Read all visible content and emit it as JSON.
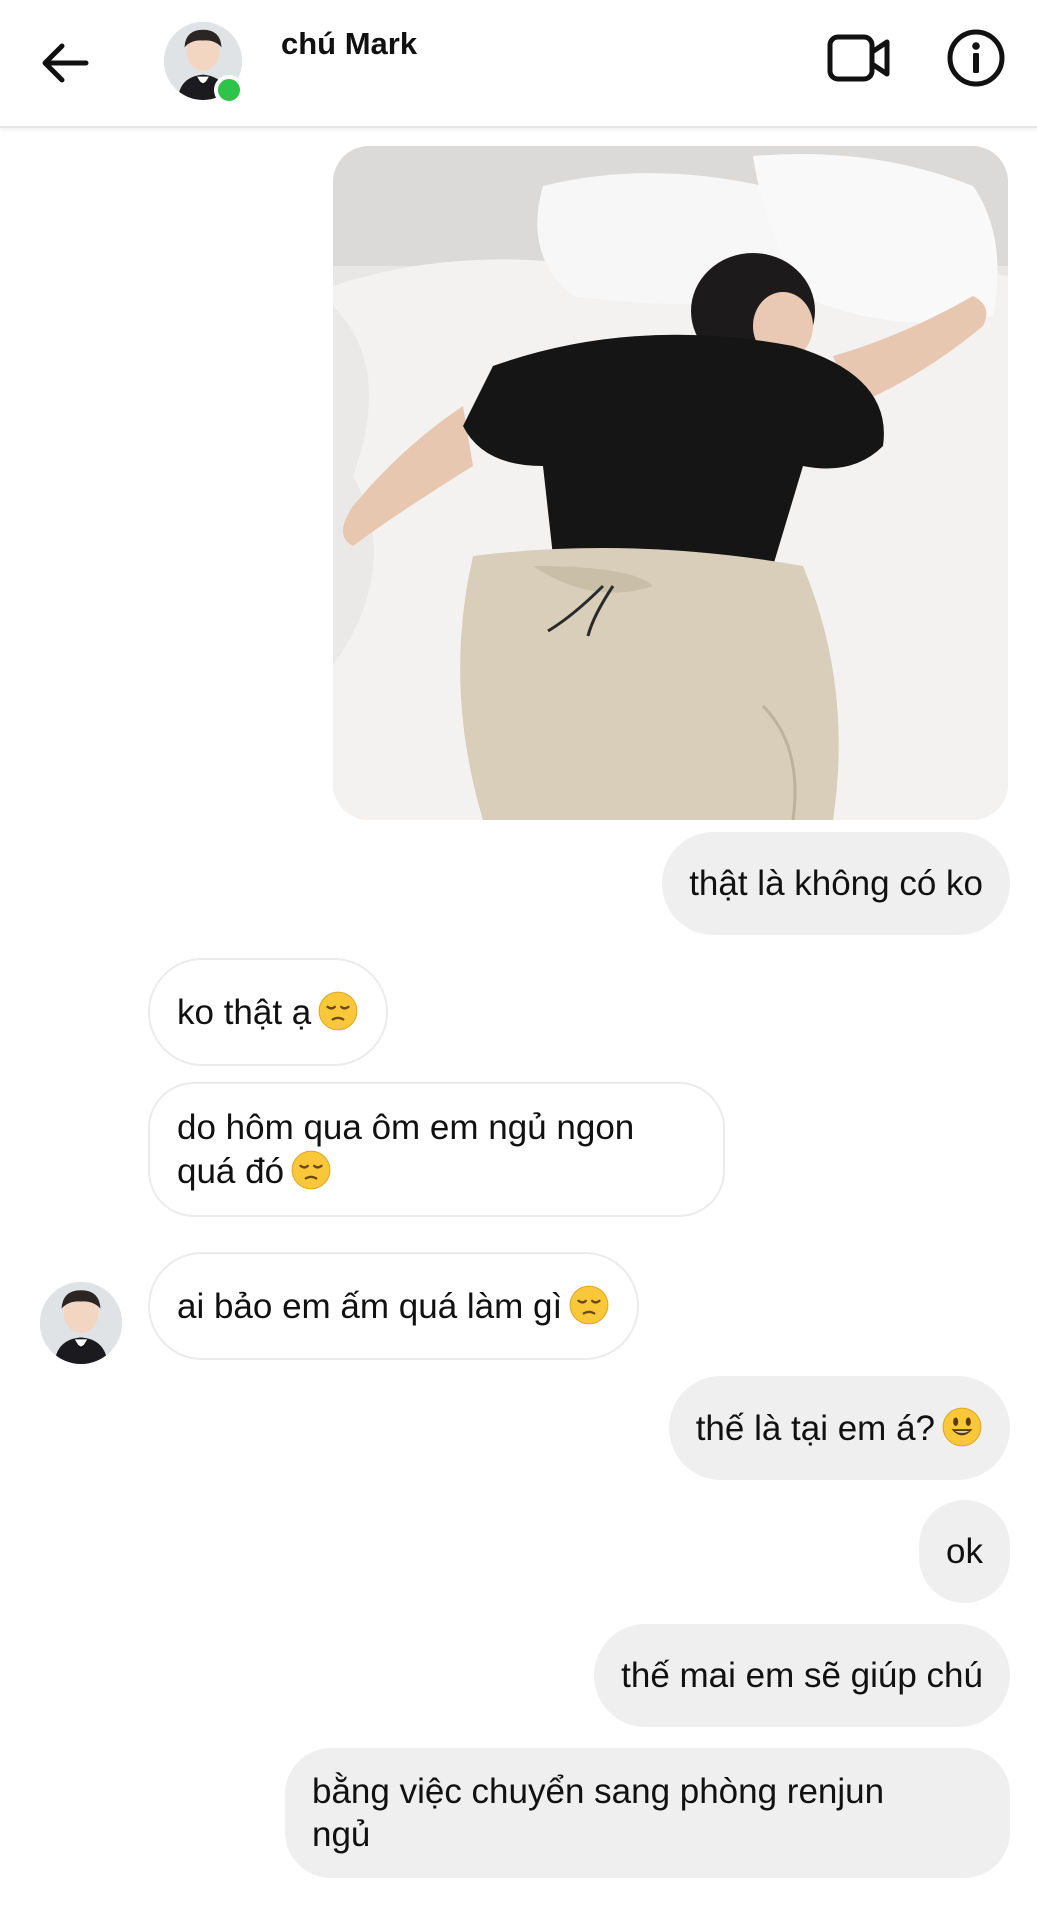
{
  "header": {
    "contact_name": "chú Mark",
    "back_icon": "arrow-left-icon",
    "video_icon": "video-camera-icon",
    "info_icon": "info-circle-icon",
    "online_color": "#2ec44a"
  },
  "messages": [
    {
      "from": "me",
      "type": "image",
      "subject": "photo"
    },
    {
      "from": "me",
      "text": "thật là không có ko"
    },
    {
      "from": "them",
      "text": "ko thật ạ",
      "emoji": "pensive-face"
    },
    {
      "from": "them",
      "text_line1": "do hôm qua ôm em ngủ ngon",
      "text_line2": "quá đó",
      "emoji": "pensive-face"
    },
    {
      "from": "them",
      "text": "ai bảo em ấm quá làm gì",
      "emoji": "pensive-face"
    },
    {
      "from": "me",
      "text": "thế là tại em á?",
      "emoji": "smiley-face"
    },
    {
      "from": "me",
      "text": "ok"
    },
    {
      "from": "me",
      "text": "thế mai em sẽ giúp chú"
    },
    {
      "from": "me",
      "text_line1": "bằng việc chuyển sang phòng renjun",
      "text_line2": "ngủ"
    }
  ],
  "colors": {
    "outgoing_bubble": "#efefef",
    "incoming_bubble": "#ffffff",
    "emoji_yellow": "#f9c83a"
  }
}
